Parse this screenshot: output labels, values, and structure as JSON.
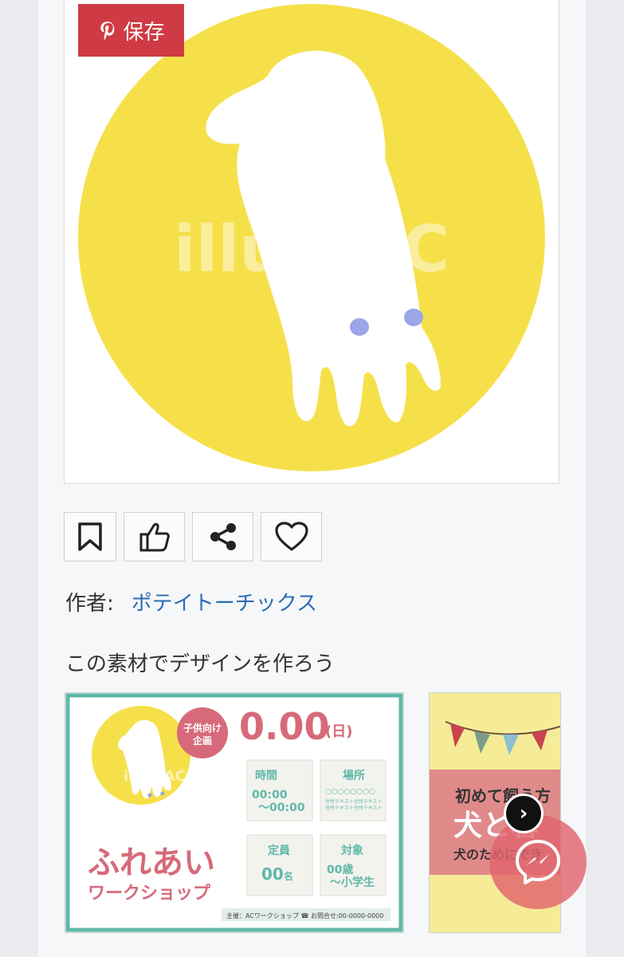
{
  "save_button": {
    "label": "保存"
  },
  "main_image": {
    "watermark": "illustAC"
  },
  "actions": [
    "bookmark-icon",
    "thumbs-up-icon",
    "share-icon",
    "heart-icon"
  ],
  "author": {
    "label": "作者:",
    "name": "ポテイトーチックス"
  },
  "design_prompt": "この素材でデザインを作ろう",
  "template1": {
    "badge": "子供向け企画",
    "badge_line1": "子供向け",
    "badge_line2": "企画",
    "date": "0.00",
    "day": "(日)",
    "time_label": "時間",
    "time_value1": "00:00",
    "time_value2": "〜00:00",
    "place_label": "場所",
    "place_value": "○○○○○○○○",
    "place_text1": "住所テキスト住所テキスト",
    "place_text2": "住所テキスト住所テキスト",
    "capacity_label": "定員",
    "capacity_value": "00",
    "capacity_unit": "名",
    "target_label": "対象",
    "target_value1": "00歳",
    "target_value2": "〜小学生",
    "title": "ふれあい",
    "subtitle": "ワークショップ",
    "footer": "主催：ACワークショップ ☎ お問合せ:00-0000-0000",
    "watermark": "illustAC"
  },
  "template2": {
    "line1": "初めて飼う方",
    "line2": "犬と暮",
    "line3": "犬のためにでき"
  },
  "colors": {
    "yellow": "#f6e04a",
    "pinterest_red": "#cf3b44",
    "teal": "#5fb8a8",
    "link": "#2a6db5",
    "pink": "#d66a7a"
  }
}
